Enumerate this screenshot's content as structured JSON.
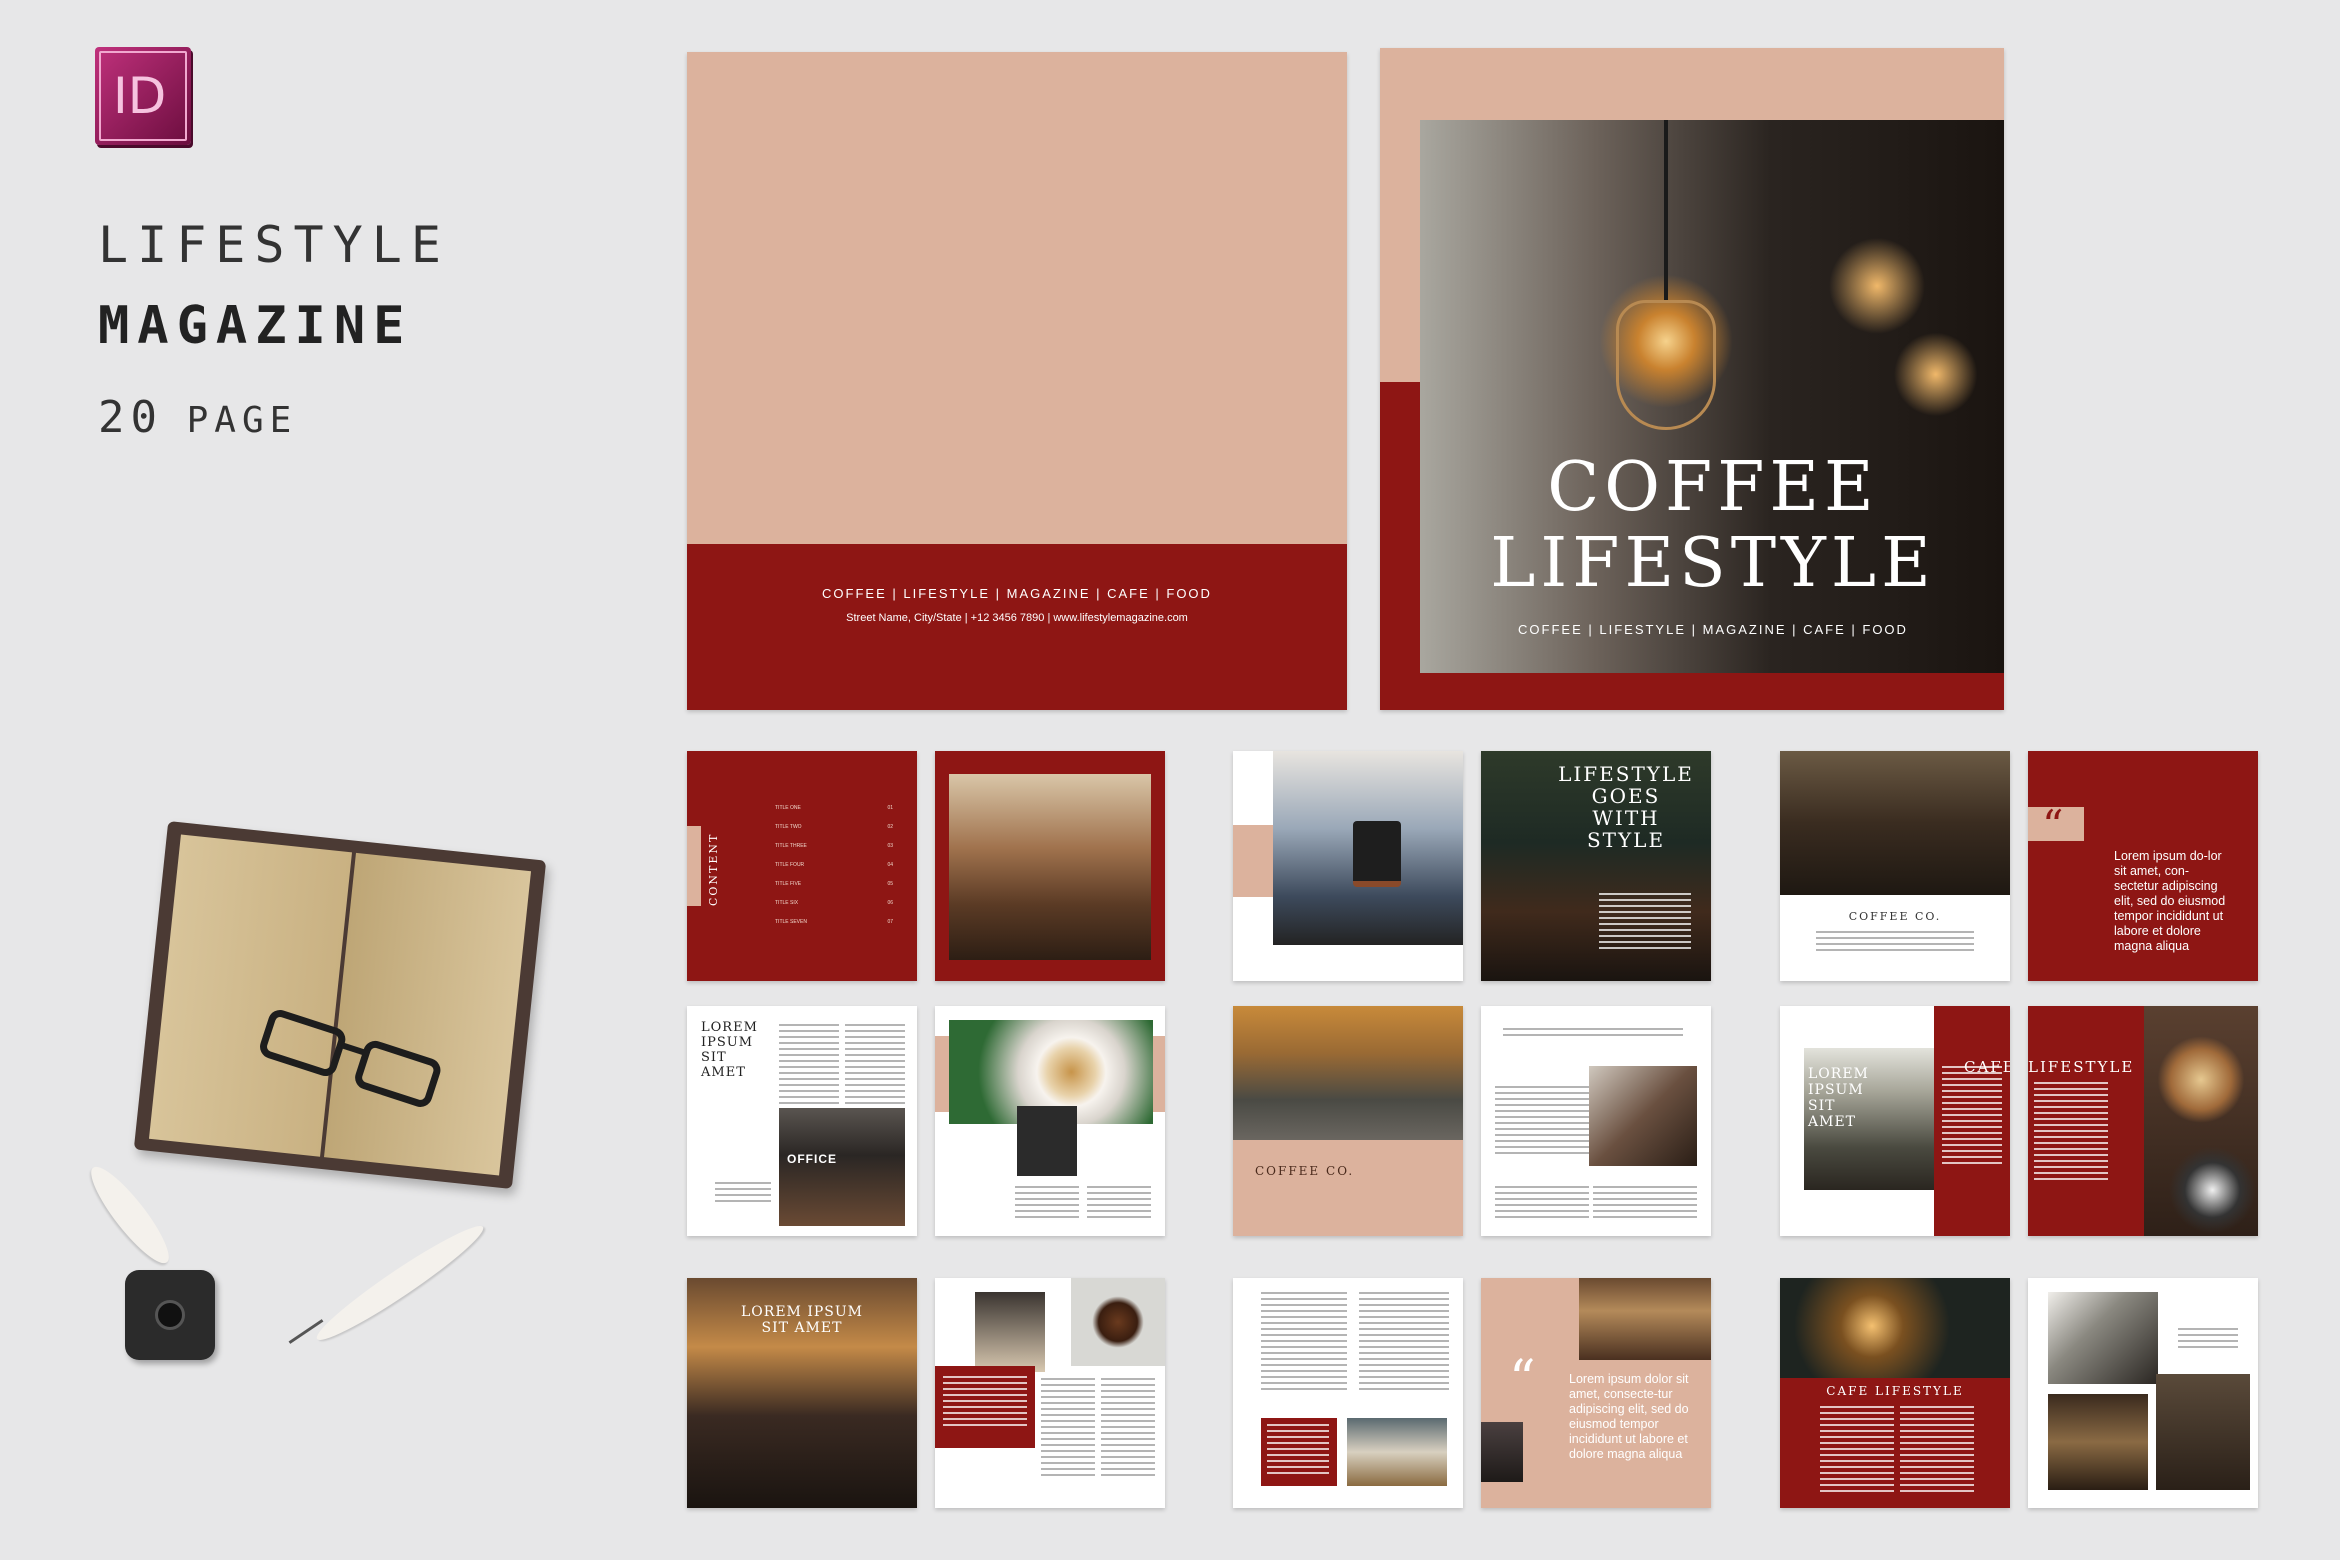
{
  "app": {
    "icon_label": "ID",
    "accent": "#8e1614",
    "pink": "#dcb29d"
  },
  "title": {
    "line1": "LIFESTYLE",
    "line2": "MAGAZINE",
    "line3_num": "20",
    "line3_word": "PAGE"
  },
  "back_cover": {
    "tagline": "COFFEE | LIFESTYLE | MAGAZINE | CAFE | FOOD",
    "address": "Street Name, City/State | +12 3456 7890 | www.lifestylemagazine.com"
  },
  "front_cover": {
    "title1": "COFFEE",
    "title2": "LIFESTYLE",
    "tagline": "COFFEE | LIFESTYLE | MAGAZINE | CAFE | FOOD"
  },
  "contents": {
    "heading": "CONTENT",
    "items": [
      {
        "label": "TITLE ONE",
        "num": "01"
      },
      {
        "label": "TITLE TWO",
        "num": "02"
      },
      {
        "label": "TITLE THREE",
        "num": "03"
      },
      {
        "label": "TITLE FOUR",
        "num": "04"
      },
      {
        "label": "TITLE FIVE",
        "num": "05"
      },
      {
        "label": "TITLE SIX",
        "num": "06"
      },
      {
        "label": "TITLE SEVEN",
        "num": "07"
      }
    ]
  },
  "spread_headlines": {
    "lifestyle_goes": [
      "LIFESTYLE",
      "GOES",
      "WITH",
      "STYLE"
    ],
    "coffee_co_1": "COFFEE CO.",
    "quote_1": "Lorem ipsum do-lor sit amet, con-sectetur adipiscing elit, sed do eiusmod tempor incididunt ut labore et dolore magna aliqua",
    "lorem_ipsum_sit_amet": [
      "LOREM",
      "IPSUM",
      "SIT",
      "AMET"
    ],
    "office_sign": "OFFICE",
    "coffee_co_2": "COFFEE CO.",
    "lorem_2": [
      "LOREM",
      "IPSUM",
      "SIT",
      "AMET"
    ],
    "cafe": "CAFE",
    "lifestyle": "LIFESTYLE",
    "lorem_3": [
      "LOREM IPSUM",
      "SIT AMET"
    ],
    "quote_2": "Lorem ipsum dolor sit amet, consecte-tur adipiscing elit, sed do eiusmod tempor incididunt ut labore et dolore magna aliqua",
    "cafe_lifestyle": "CAFE LIFESTYLE"
  }
}
